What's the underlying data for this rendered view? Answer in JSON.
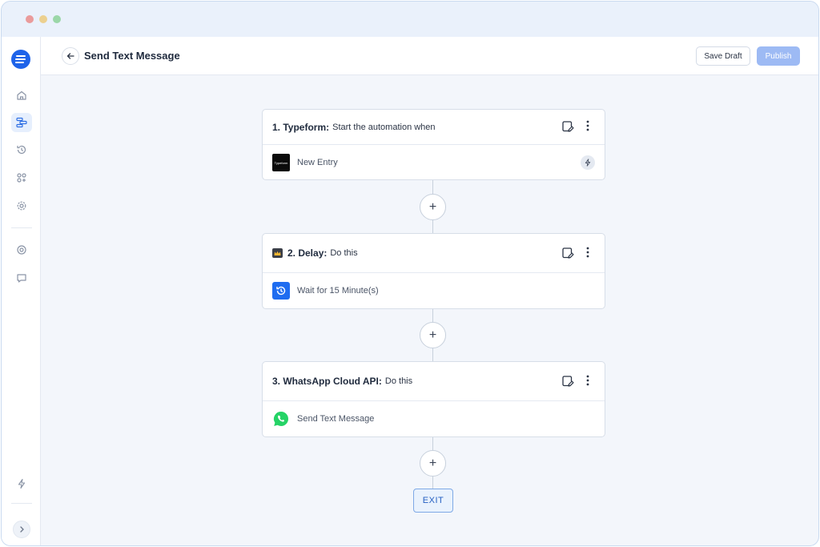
{
  "header": {
    "title": "Send Text Message",
    "save_draft_label": "Save Draft",
    "publish_label": "Publish"
  },
  "sidebar": {
    "items": [
      {
        "icon": "home-icon",
        "active": false
      },
      {
        "icon": "automation-flow-icon",
        "active": true
      },
      {
        "icon": "history-icon",
        "active": false
      },
      {
        "icon": "integrations-icon",
        "active": false
      },
      {
        "icon": "settings-icon",
        "active": false
      },
      {
        "icon": "support-icon",
        "active": false
      },
      {
        "icon": "feedback-icon",
        "active": false
      },
      {
        "icon": "bolt-icon",
        "active": false
      }
    ]
  },
  "steps": [
    {
      "title": "1. Typeform:",
      "subtitle": "Start the automation when",
      "body": "New Entry",
      "logo_text": "Typeform"
    },
    {
      "title": "2. Delay:",
      "subtitle": "Do this",
      "body": "Wait for 15 Minute(s)"
    },
    {
      "title": "3. WhatsApp Cloud API:",
      "subtitle": "Do this",
      "body": "Send Text Message"
    }
  ],
  "add_step_label": "+",
  "exit_label": "EXIT",
  "colors": {
    "accent": "#1e63e9",
    "publish_disabled": "#9dbaf4",
    "whatsapp": "#25d366"
  }
}
